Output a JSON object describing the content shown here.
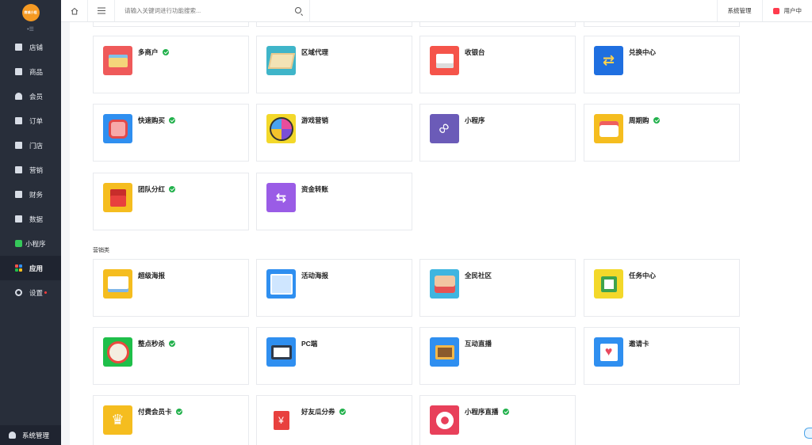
{
  "sidebar": {
    "logo_text": "商城小程",
    "collapse_label": "•☰",
    "items": [
      {
        "label": "店铺"
      },
      {
        "label": "商品"
      },
      {
        "label": "会员"
      },
      {
        "label": "订单"
      },
      {
        "label": "门店"
      },
      {
        "label": "营销"
      },
      {
        "label": "财务"
      },
      {
        "label": "数据"
      },
      {
        "label": "小程序"
      },
      {
        "label": "应用",
        "active": true
      },
      {
        "label": "设置"
      }
    ],
    "bottom_label": "系统管理"
  },
  "topbar": {
    "search_placeholder": "请输入关键词进行功能搜索...",
    "system_label": "系统管理",
    "user_center_label": "用户中"
  },
  "apps": [
    {
      "title": "多商户",
      "badge": true,
      "icon": "shop-icon",
      "color": "#ef5a5a"
    },
    {
      "title": "区域代理",
      "badge": false,
      "icon": "map-icon",
      "color": "#3fb5c9"
    },
    {
      "title": "收银台",
      "badge": false,
      "icon": "cash-register-icon",
      "color": "#f5544a"
    },
    {
      "title": "兑换中心",
      "badge": false,
      "icon": "exchange-icon",
      "color": "#1f6fe0"
    },
    {
      "title": "快速购买",
      "badge": true,
      "icon": "cart-icon",
      "color": "#2f8ff0"
    },
    {
      "title": "游戏营销",
      "badge": false,
      "icon": "wheel-icon",
      "color": "#f3d82a"
    },
    {
      "title": "小程序",
      "badge": false,
      "icon": "mini-program-icon",
      "color": "#6b5bb8"
    },
    {
      "title": "周期购",
      "badge": true,
      "icon": "calendar-icon",
      "color": "#f5bd1f"
    },
    {
      "title": "团队分红",
      "badge": true,
      "icon": "red-envelope-icon",
      "color": "#f5bd1f"
    },
    {
      "title": "资金转账",
      "badge": false,
      "icon": "transfer-icon",
      "color": "#9a5ce6"
    }
  ],
  "marketing": {
    "section_label": "营销类",
    "apps": [
      {
        "title": "超级海报",
        "badge": false,
        "icon": "poster-icon",
        "color": "#f5bd1f"
      },
      {
        "title": "活动海报",
        "badge": false,
        "icon": "activity-poster-icon",
        "color": "#2f8ff0"
      },
      {
        "title": "全民社区",
        "badge": false,
        "icon": "community-icon",
        "color": "#3fb5e0"
      },
      {
        "title": "任务中心",
        "badge": false,
        "icon": "task-icon",
        "color": "#f3d82a"
      },
      {
        "title": "整点秒杀",
        "badge": true,
        "icon": "alarm-clock-icon",
        "color": "#1fbf4a"
      },
      {
        "title": "PC端",
        "badge": false,
        "icon": "pc-icon",
        "color": "#2f8ff0"
      },
      {
        "title": "互动直播",
        "badge": false,
        "icon": "tv-icon",
        "color": "#2f8ff0"
      },
      {
        "title": "邀请卡",
        "badge": false,
        "icon": "invite-card-icon",
        "color": "#2f8ff0"
      },
      {
        "title": "付费会员卡",
        "badge": true,
        "icon": "vip-crown-icon",
        "color": "#f5bd1f"
      },
      {
        "title": "好友瓜分券",
        "badge": true,
        "icon": "red-packet-icon",
        "color": "#fff"
      },
      {
        "title": "小程序直播",
        "badge": true,
        "icon": "live-play-icon",
        "color": "#e8405a"
      }
    ]
  }
}
